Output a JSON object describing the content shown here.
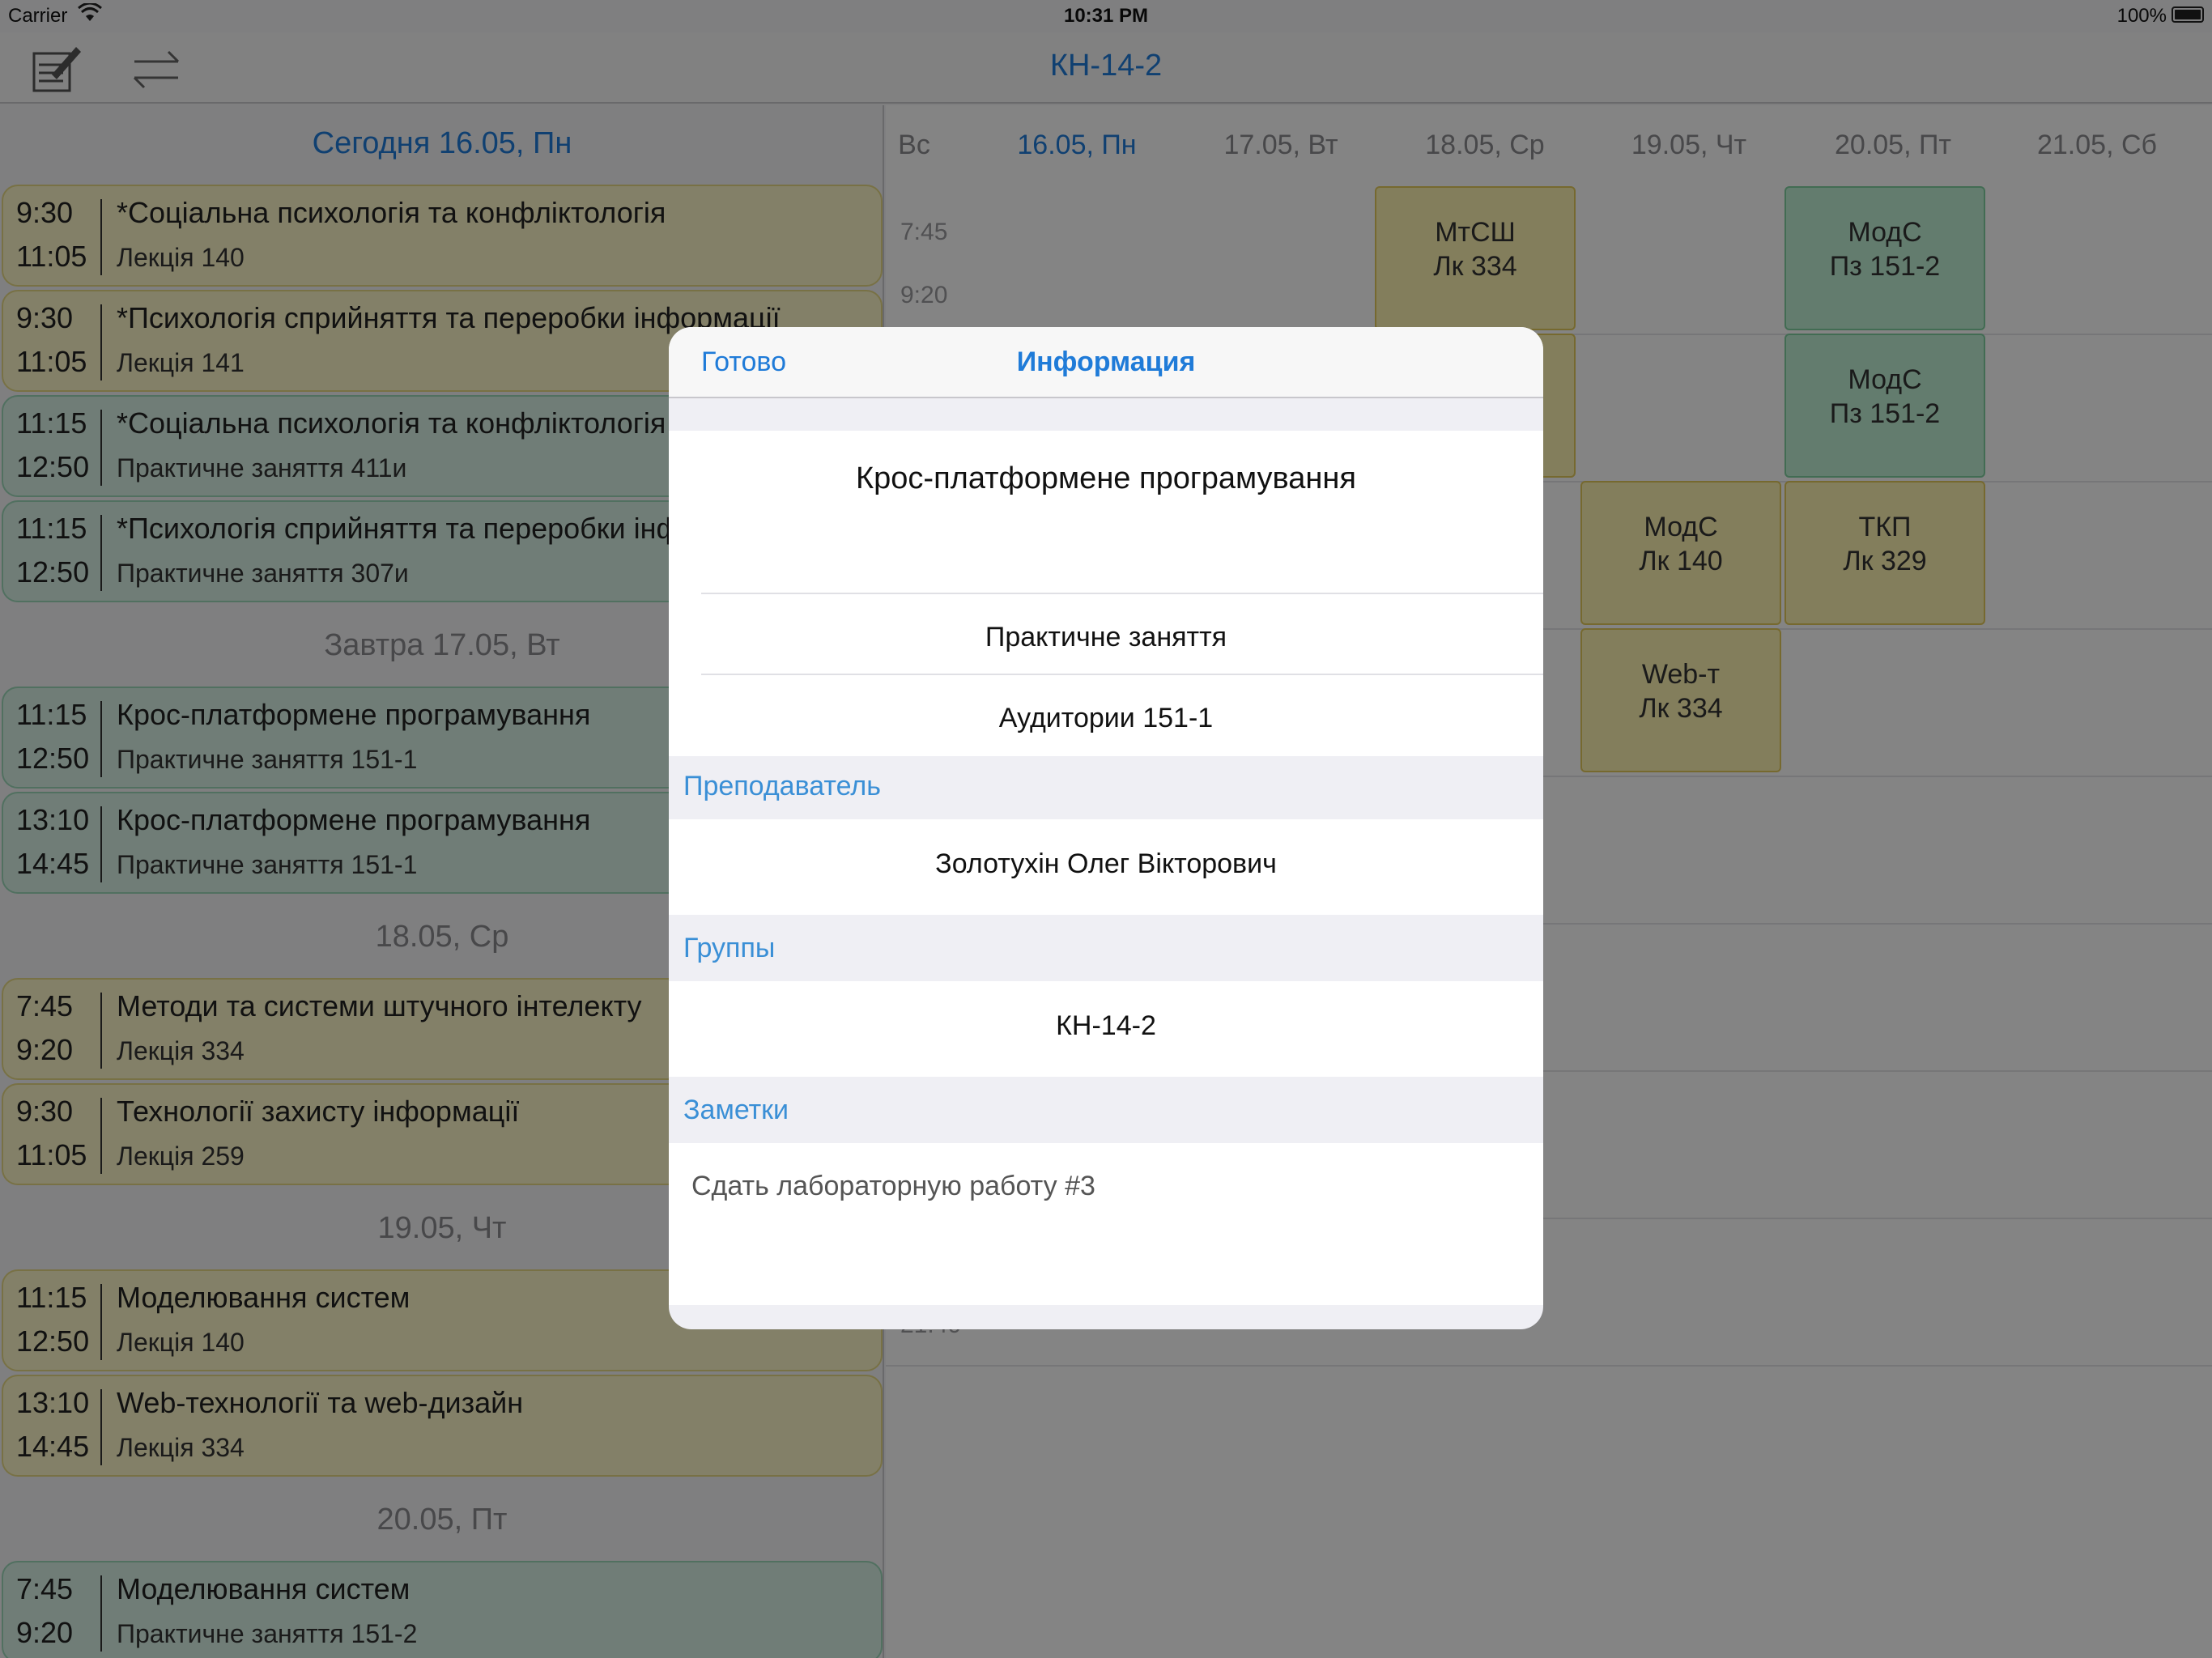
{
  "status_bar": {
    "carrier": "Carrier",
    "time": "10:31 PM",
    "battery": "100%"
  },
  "nav": {
    "title": "КН-14-2",
    "left_icon": "notes-edit-icon",
    "right_icon": "swap-arrows-icon"
  },
  "days": [
    {
      "header": "Сегодня 16.05, Пн",
      "lessons": [
        {
          "start": "9:30",
          "end": "11:05",
          "subject": "*Соціальна психологія та конфліктологія",
          "detail": "Лекція 140",
          "color": "yellow"
        },
        {
          "start": "9:30",
          "end": "11:05",
          "subject": "*Психологія сприйняття та переробки інформації",
          "detail": "Лекція 141",
          "color": "yellow"
        },
        {
          "start": "11:15",
          "end": "12:50",
          "subject": "*Соціальна психологія та конфліктологія",
          "detail": "Практичне заняття 411и",
          "color": "green"
        },
        {
          "start": "11:15",
          "end": "12:50",
          "subject": "*Психологія сприйняття та переробки інформації",
          "detail": "Практичне заняття 307и",
          "color": "green"
        }
      ]
    },
    {
      "header": "Завтра 17.05, Вт",
      "lessons": [
        {
          "start": "11:15",
          "end": "12:50",
          "subject": "Крос-платформене програмування",
          "detail": "Практичне заняття 151-1",
          "color": "green"
        },
        {
          "start": "13:10",
          "end": "14:45",
          "subject": "Крос-платформене програмування",
          "detail": "Практичне заняття 151-1",
          "color": "green"
        }
      ]
    },
    {
      "header": "18.05, Ср",
      "lessons": [
        {
          "start": "7:45",
          "end": "9:20",
          "subject": "Методи та системи штучного інтелекту",
          "detail": "Лекція 334",
          "color": "yellow"
        },
        {
          "start": "9:30",
          "end": "11:05",
          "subject": "Технології захисту інформації",
          "detail": "Лекція 259",
          "color": "yellow"
        }
      ]
    },
    {
      "header": "19.05, Чт",
      "lessons": [
        {
          "start": "11:15",
          "end": "12:50",
          "subject": "Моделювання систем",
          "detail": "Лекція 140",
          "color": "yellow"
        },
        {
          "start": "13:10",
          "end": "14:45",
          "subject": "Web-технології та web-дизайн",
          "detail": "Лекція 334",
          "color": "yellow"
        }
      ]
    },
    {
      "header": "20.05, Пт",
      "lessons": [
        {
          "start": "7:45",
          "end": "9:20",
          "subject": "Моделювання систем",
          "detail": "Практичне заняття 151-2",
          "color": "green"
        }
      ]
    }
  ],
  "week": {
    "days": [
      "Вс",
      "16.05, Пн",
      "17.05, Вт",
      "18.05, Ср",
      "19.05, Чт",
      "20.05, Пт",
      "21.05, Сб"
    ],
    "times": [
      "7:45",
      "9:20",
      "21:40"
    ],
    "cells": [
      {
        "title": "МтСШ",
        "room": "Лк 334",
        "color": "yellow"
      },
      {
        "title": "МодС",
        "room": "Пз 151-2",
        "color": "green"
      },
      {
        "title": "",
        "room": "",
        "color": "yellow"
      },
      {
        "title": "МодС",
        "room": "Пз 151-2",
        "color": "green"
      },
      {
        "title": "МодС",
        "room": "Лк 140",
        "color": "yellow"
      },
      {
        "title": "ТКП",
        "room": "Лк 329",
        "color": "yellow"
      },
      {
        "title": "Web-т",
        "room": "Лк 334",
        "color": "yellow"
      }
    ]
  },
  "modal": {
    "done": "Готово",
    "title": "Информация",
    "subject": "Крос-платформене програмування",
    "type": "Практичне заняття",
    "room": "Аудитории 151-1",
    "teacher_header": "Преподаватель",
    "teacher": "Золотухін Олег Вікторович",
    "groups_header": "Группы",
    "group": "КН-14-2",
    "notes_header": "Заметки",
    "notes": "Сдать лабораторную работу #3"
  }
}
